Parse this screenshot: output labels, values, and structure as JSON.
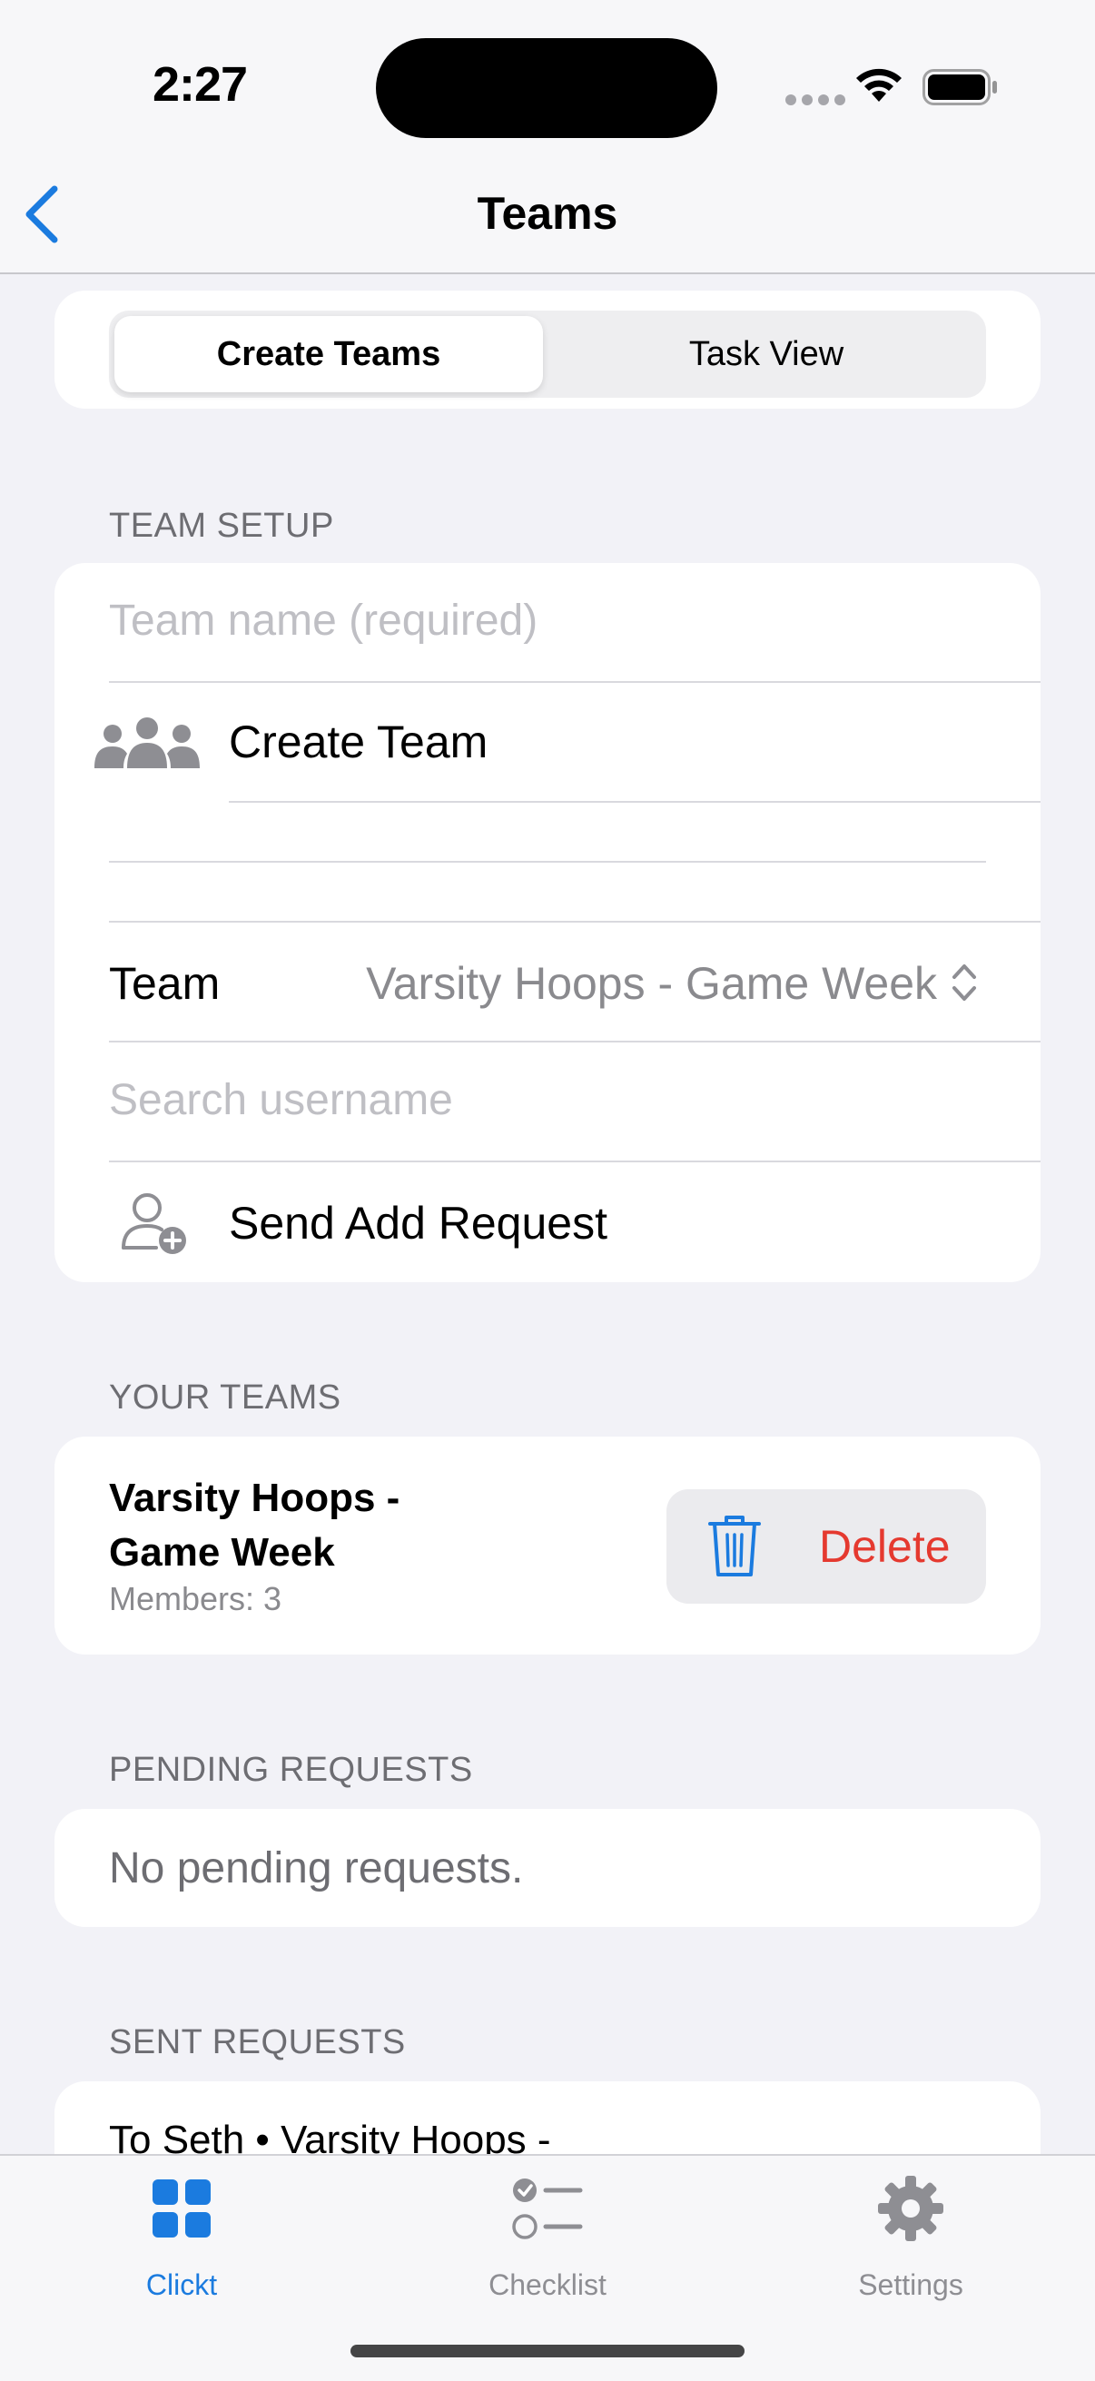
{
  "status_bar": {
    "time": "2:27"
  },
  "nav": {
    "title": "Teams"
  },
  "segmented": {
    "options": [
      "Create Teams",
      "Task View"
    ],
    "selected": "Create Teams"
  },
  "team_setup": {
    "header": "TEAM SETUP",
    "team_name_placeholder": "Team name (required)",
    "create_label": "Create Team",
    "team_label": "Team",
    "team_value": "Varsity Hoops - Game Week",
    "search_placeholder": "Search username",
    "send_label": "Send Add Request"
  },
  "your_teams": {
    "header": "YOUR TEAMS",
    "items": [
      {
        "name_line1": "Varsity Hoops -",
        "name_line2": "Game Week",
        "members": "Members: 3",
        "delete_label": "Delete"
      }
    ]
  },
  "pending": {
    "header": "PENDING REQUESTS",
    "empty": "No pending requests."
  },
  "sent": {
    "header": "SENT REQUESTS",
    "first": "To Seth • Varsity Hoops -"
  },
  "tabbar": {
    "items": [
      {
        "label": "Clickt",
        "icon": "grid-icon",
        "active": true
      },
      {
        "label": "Checklist",
        "icon": "checklist-icon",
        "active": false
      },
      {
        "label": "Settings",
        "icon": "gear-icon",
        "active": false
      }
    ]
  },
  "colors": {
    "accent": "#1B7BDF",
    "destructive": "#E5392F",
    "inactive": "#8E8E93"
  }
}
